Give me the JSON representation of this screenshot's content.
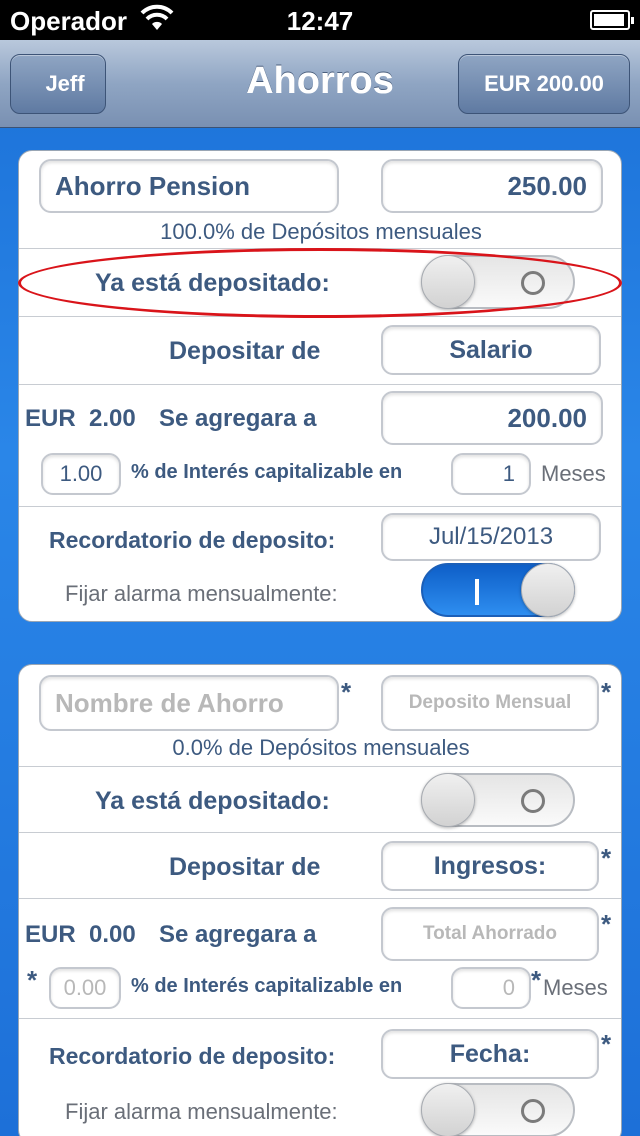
{
  "status_bar": {
    "carrier": "Operador",
    "time": "12:47"
  },
  "nav": {
    "back_label": "Jeff",
    "title": "Ahorros",
    "balance": "EUR 200.00"
  },
  "card1": {
    "name_value": "Ahorro Pension",
    "amount_value": "250.00",
    "percent_text": "100.0% de Depósitos mensuales",
    "deposited_label": "Ya está depositado:",
    "deposited_on": false,
    "deposit_from_label": "Depositar de",
    "deposit_from_value": "Salario",
    "currency_text": "EUR  2.00",
    "added_to_label": "Se agregara a",
    "added_to_value": "200.00",
    "interest_value": "1.00",
    "interest_label": "% de Interés capitalizable en",
    "months_value": "1",
    "months_label": "Meses",
    "reminder_label": "Recordatorio de deposito:",
    "reminder_value": "Jul/15/2013",
    "alarm_label": "Fijar alarma mensualmente:",
    "alarm_on": true
  },
  "card2": {
    "name_placeholder": "Nombre de Ahorro",
    "amount_placeholder": "Deposito Mensual",
    "percent_text": "0.0% de Depósitos mensuales",
    "deposited_label": "Ya está depositado:",
    "deposited_on": false,
    "deposit_from_label": "Depositar de",
    "deposit_from_value": "Ingresos:",
    "currency_text": "EUR  0.00",
    "added_to_label": "Se agregara a",
    "added_to_placeholder": "Total Ahorrado",
    "interest_placeholder": "0.00",
    "interest_label": "% de Interés capitalizable en",
    "months_placeholder": "0",
    "months_label": "Meses",
    "reminder_label": "Recordatorio de deposito:",
    "reminder_value": "Fecha:",
    "alarm_label": "Fijar alarma mensualmente:",
    "alarm_on": false,
    "required_mark": "*"
  },
  "colors": {
    "highlight": "#d9141a",
    "toggle_on": "#1b74e4",
    "label_text": "#3d5a80"
  }
}
